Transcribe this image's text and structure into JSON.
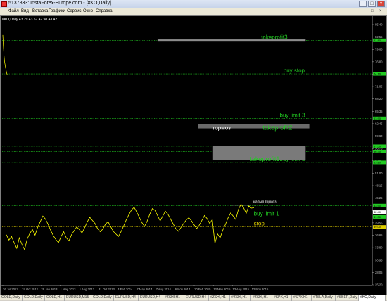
{
  "window": {
    "title": "5137833: InstaForex-Europe.com - [#KO,Daily]",
    "controls": [
      "_",
      "□",
      "×"
    ]
  },
  "menu": {
    "items": [
      "Файл",
      "Вид",
      "Вставка",
      "Графики",
      "Сервис",
      "Окно",
      "Справка"
    ],
    "controls": [
      "_",
      "□",
      "×"
    ]
  },
  "chart_info": "#KO,Daily 43.29 43.57 42.98 43.42",
  "chart_data": {
    "type": "line",
    "symbol": "#KO",
    "timeframe": "Daily",
    "ylim": [
      25.72,
      85.4
    ],
    "price_ticks": [
      "85.40",
      "82.55",
      "79.65",
      "76.80",
      "73.95",
      "71.05",
      "68.20",
      "65.35",
      "62.45",
      "59.60",
      "56.75",
      "53.85",
      "51.00",
      "48.15",
      "45.25",
      "42.40",
      "39.55",
      "36.65",
      "33.80",
      "30.95",
      "28.05",
      "25.20"
    ],
    "date_ticks": [
      "26 Jul 2012",
      "24 Oct 2012",
      "29 Jan 2013",
      "1 May 2013",
      "1 Aug 2013",
      "31 Oct 2013",
      "4 Feb 2014",
      "7 May 2014",
      "7 Aug 2014",
      "6 Nov 2014",
      "10 Feb 2015",
      "13 May 2015",
      "13 Aug 2015",
      "12 Nov 2015"
    ],
    "series": [
      {
        "values": [
          83.0,
          80.5,
          78.5,
          77.0,
          76.2,
          75.5,
          74.8,
          74.2,
          73.8
        ]
      },
      {
        "values": [
          37.2,
          36.0,
          36.8,
          35.4,
          34.1,
          36.5,
          35.0,
          33.8,
          36.2,
          37.5,
          38.4,
          37.1,
          38.9,
          40.2,
          41.5,
          40.8,
          39.6,
          38.2,
          37.0,
          36.1,
          35.4,
          36.8,
          37.9,
          36.5,
          35.8,
          37.2,
          38.1,
          39.0,
          38.4,
          37.6,
          38.8,
          40.1,
          41.2,
          40.5,
          39.8,
          38.6,
          37.9,
          38.5,
          39.6,
          40.2,
          39.1,
          38.0,
          37.4,
          36.8,
          37.9,
          39.2,
          40.6,
          41.8,
          42.9,
          43.5,
          42.4,
          41.2,
          40.0,
          39.1,
          40.3,
          41.9,
          43.2,
          42.8,
          41.6,
          40.4,
          41.5,
          42.6,
          41.9,
          40.8,
          39.7,
          38.6,
          38.0,
          38.9,
          39.8,
          40.6,
          41.1,
          40.4,
          39.5,
          38.6,
          39.4,
          40.5,
          41.6,
          40.9,
          39.8,
          40.7,
          35.2,
          37.4,
          36.5,
          38.2,
          39.5,
          41.0,
          42.2,
          41.5,
          40.7,
          43.0,
          44.2,
          43.4,
          42.1,
          43.8,
          43.3,
          43.4
        ]
      }
    ],
    "levels": [
      {
        "label": "takeprofit3",
        "price": 81.8,
        "color": "#22cc22",
        "tag": "81.80"
      },
      {
        "label": "buy stop",
        "price": 74.1,
        "color": "#22cc22",
        "tag": "74.10"
      },
      {
        "label": "buy limit 3",
        "price": 63.9,
        "color": "#22cc22",
        "tag": "63.90"
      },
      {
        "label": "",
        "price": 57.5,
        "color": "#22cc22",
        "tag": "57.50"
      },
      {
        "label": "",
        "price": 56.3,
        "color": "#22cc22",
        "tag": "56.30"
      },
      {
        "label": "buy limit 2",
        "price": 53.8,
        "color": "#22cc22",
        "tag": "53.80"
      },
      {
        "label": "",
        "price": 43.9,
        "color": "#22cc22",
        "tag": "43.90"
      },
      {
        "label": "buy limit 1",
        "price": 41.3,
        "color": "#22cc22",
        "tag": "41.30"
      },
      {
        "label": "stop",
        "price": 39.0,
        "color": "#ddcc00",
        "tag": "39.00"
      }
    ],
    "current_price": {
      "price": 42.4,
      "tag": "42.40"
    },
    "boxes": [
      {
        "label": "",
        "from": 0.42,
        "to": 0.82,
        "top": 82.0,
        "bottom": 81.5,
        "color": "#8c8c8c",
        "text_color": "#22cc22"
      },
      {
        "label": "тормоз",
        "from": 0.53,
        "to": 0.83,
        "top": 62.6,
        "bottom": 61.6,
        "color": "#6a6a6a",
        "text_color": "#ffffff"
      },
      {
        "label": "takeprofit2",
        "from": 0.64,
        "to": 0.8,
        "top": 62.6,
        "bottom": 61.6,
        "color": null,
        "text_color": "#22cc22"
      },
      {
        "label": "takeprofit1",
        "from": 0.57,
        "to": 0.82,
        "top": 57.6,
        "bottom": 54.4,
        "color": "#7a7a7a",
        "text_color": "#22cc22"
      }
    ],
    "brake_small": {
      "label": "малый тормоз",
      "from": 0.62,
      "to": 0.67,
      "price": 44.0
    },
    "grid": false
  },
  "tabs": [
    "GOLD,Daily",
    "GOLD,Daily",
    "GOLD,H1",
    "EURUSD,M15",
    "GOLD,Daily",
    "EURUSD,H4",
    "EURUSD,H4",
    "#ZSHI,H1",
    "EURUSD,H4",
    "#ZSHI,H1",
    "#ZSHI,H1",
    "#ZSHI,H1",
    "#SPX,H1",
    "#SPX,H1",
    "#TSLA,Daily",
    "#SBER,Daily",
    "#KO,Daily"
  ],
  "active_tab": 16,
  "colors": {
    "price_line": "#ffff00",
    "level_line": "#22cc22",
    "background": "#000000",
    "axis_text": "#c0c0c0"
  }
}
